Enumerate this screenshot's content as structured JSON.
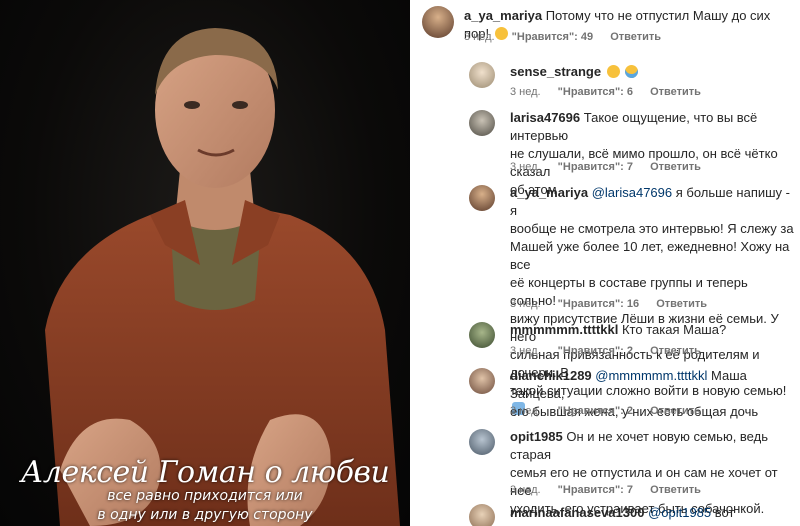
{
  "video": {
    "caption_title": "Алексей Гоман о любви",
    "caption_line1": "все равно приходится или",
    "caption_line2": "в одну или в другую сторону"
  },
  "comments": [
    {
      "user": "a_ya_mariya",
      "mention": "",
      "text": "Потому что не отпустил Машу до сих пор!",
      "emoji": "sad-face-emoji",
      "time": "3 нед.",
      "likes": "\"Нравится\": 49",
      "reply": "Ответить"
    },
    {
      "user": "sense_strange",
      "mention": "",
      "text": "",
      "emoji": "surprised-and-crying-emoji",
      "time": "3 нед.",
      "likes": "\"Нравится\": 6",
      "reply": "Ответить"
    },
    {
      "user": "larisa47696",
      "mention": "",
      "text_lines": [
        "Такое ощущение, что вы всё интервью",
        "не слушали, всё мимо прошло, он всё чётко сказал",
        "об этом"
      ],
      "time": "3 нед.",
      "likes": "\"Нравится\": 7",
      "reply": "Ответить"
    },
    {
      "user": "a_ya_mariya",
      "mention": "@larisa47696",
      "text_lines": [
        "я больше напишу - я",
        "вообще не смотрела это интервью! Я слежу за",
        "Машей уже более 10 лет, ежедневно! Хожу на все",
        "её концерты в составе группы и теперь сольно!",
        "вижу присутствие Лёши в жизни её семьи. У него",
        "сильная привязанность к её родителям и дочери. В",
        "такой ситуации сложно войти в новую семью!"
      ],
      "emoji": "raising-hands-emoji",
      "time": "3 нед.",
      "likes": "\"Нравится\": 16",
      "reply": "Ответить"
    },
    {
      "user": "mmmmmm.ttttkkl",
      "mention": "",
      "text": "Кто такая Маша?",
      "time": "3 нед.",
      "likes": "\"Нравится\": 2",
      "reply": "Ответить"
    },
    {
      "user": "dianchik1289",
      "mention": "@mmmmmm.ttttkkl",
      "text_lines": [
        "Маша Зайцева,",
        "его бывшая жена, у них есть общая дочь"
      ],
      "time": "3 нед.",
      "likes": "\"Нравится\": 2",
      "reply": "Ответить"
    },
    {
      "user": "opit1985",
      "mention": "",
      "text_lines": [
        "Он и не хочет новую семью, ведь старая",
        "семья его не отпустила и он сам не хочет от нее",
        "уходить, его устраивает быть собачонкой."
      ],
      "time": "3 нед.",
      "likes": "\"Нравится\": 7",
      "reply": "Ответить"
    },
    {
      "user": "marinaafanaseva1300",
      "mention": "@opit1985",
      "text": "вот правильно"
    }
  ]
}
